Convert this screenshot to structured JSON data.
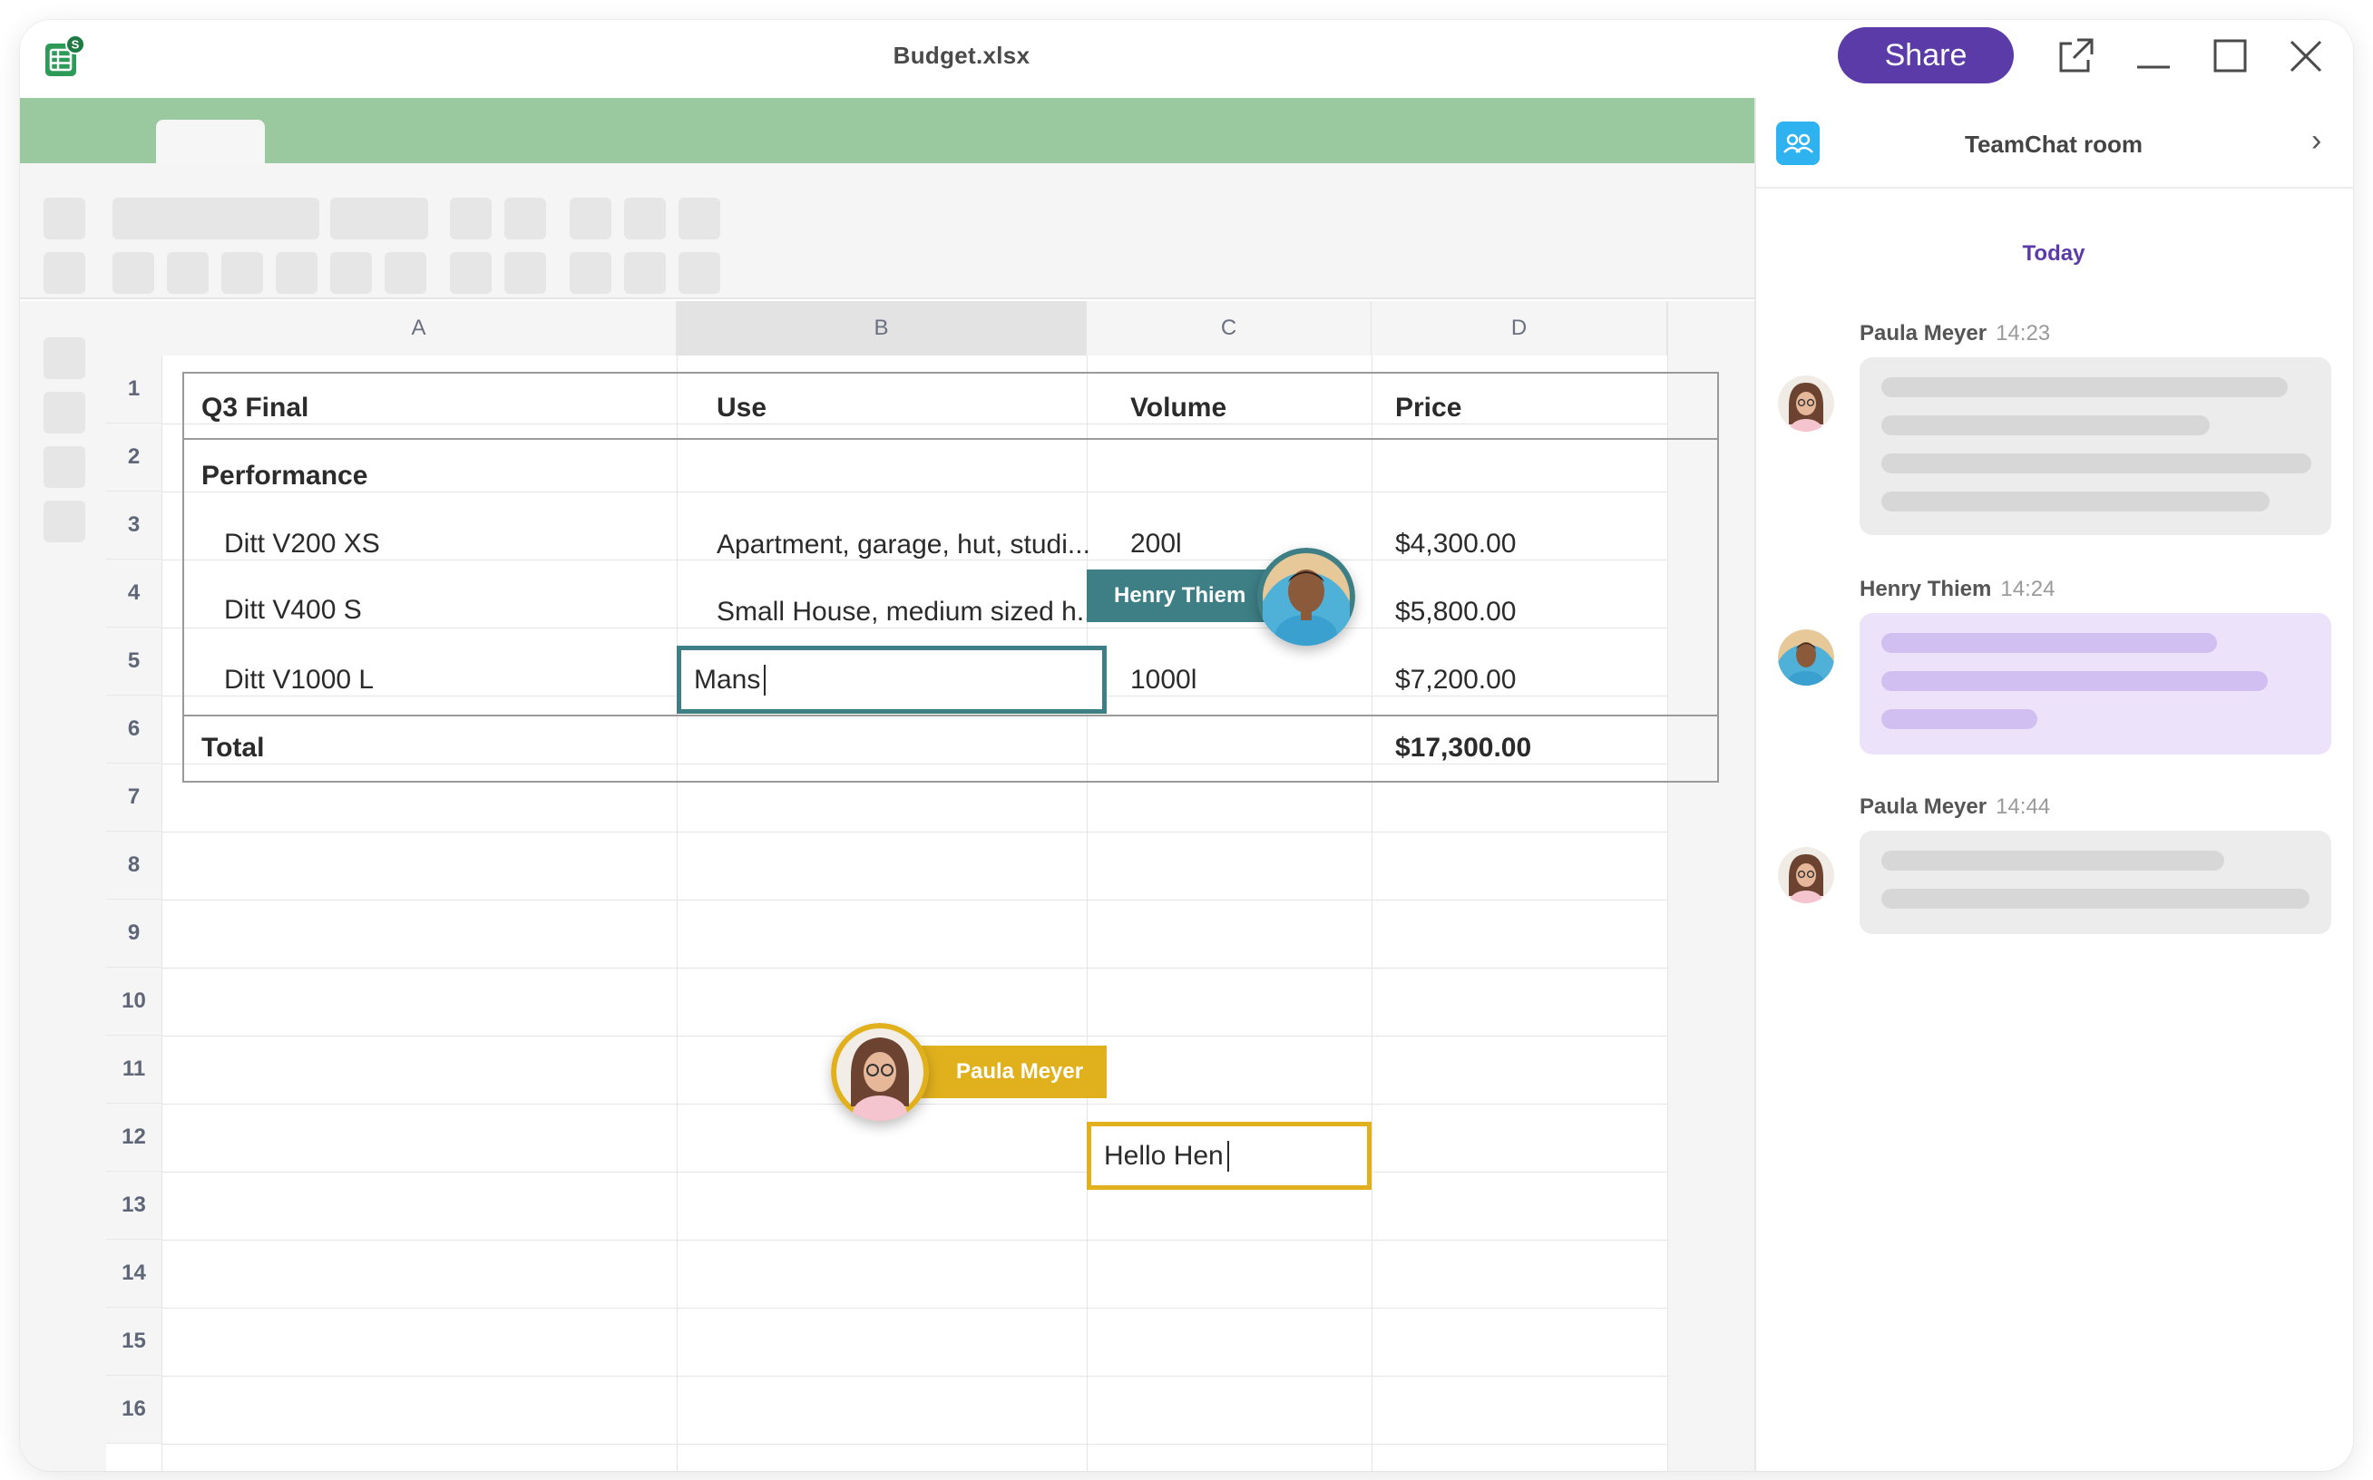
{
  "window": {
    "title": "Budget.xlsx",
    "share_label": "Share"
  },
  "colors": {
    "accent": "#5b3ba8",
    "ribbon": "#9ac99f",
    "henry": "#3d7f85",
    "paula": "#e1b11d"
  },
  "icons": [
    "spreadsheet-app-icon",
    "open-external-icon",
    "minimize-icon",
    "maximize-icon",
    "close-icon",
    "team-icon",
    "chevron-right-icon"
  ],
  "sheet": {
    "columns": [
      "A",
      "B",
      "C",
      "D"
    ],
    "selected_column": "B",
    "rows": [
      "1",
      "2",
      "3",
      "4",
      "5",
      "6",
      "7",
      "8",
      "9",
      "10",
      "11",
      "12",
      "13",
      "14",
      "15",
      "16"
    ],
    "cells": {
      "a1": "Q3 Final",
      "b1": "Use",
      "c1": "Volume",
      "d1": "Price",
      "a2": "Performance",
      "a3": "Ditt V200 XS",
      "b3": "Apartment, garage, hut, studi...",
      "c3": "200l",
      "d3": "$4,300.00",
      "a4": "Ditt V400 S",
      "b4": "Small House, medium sized h...",
      "d4": "$5,800.00",
      "a5": "Ditt V1000 L",
      "b5": "Mans",
      "c5": "1000l",
      "d5": "$7,200.00",
      "a6": "Total",
      "d6": "$17,300.00",
      "c12": "Hello Hen"
    }
  },
  "presence": {
    "henry": {
      "name": "Henry Thiem"
    },
    "paula": {
      "name": "Paula Meyer"
    }
  },
  "chat": {
    "title": "TeamChat room",
    "day_label": "Today",
    "messages": [
      {
        "author": "Paula Meyer",
        "time": "14:23"
      },
      {
        "author": "Henry Thiem",
        "time": "14:24"
      },
      {
        "author": "Paula Meyer",
        "time": "14:44"
      }
    ]
  }
}
